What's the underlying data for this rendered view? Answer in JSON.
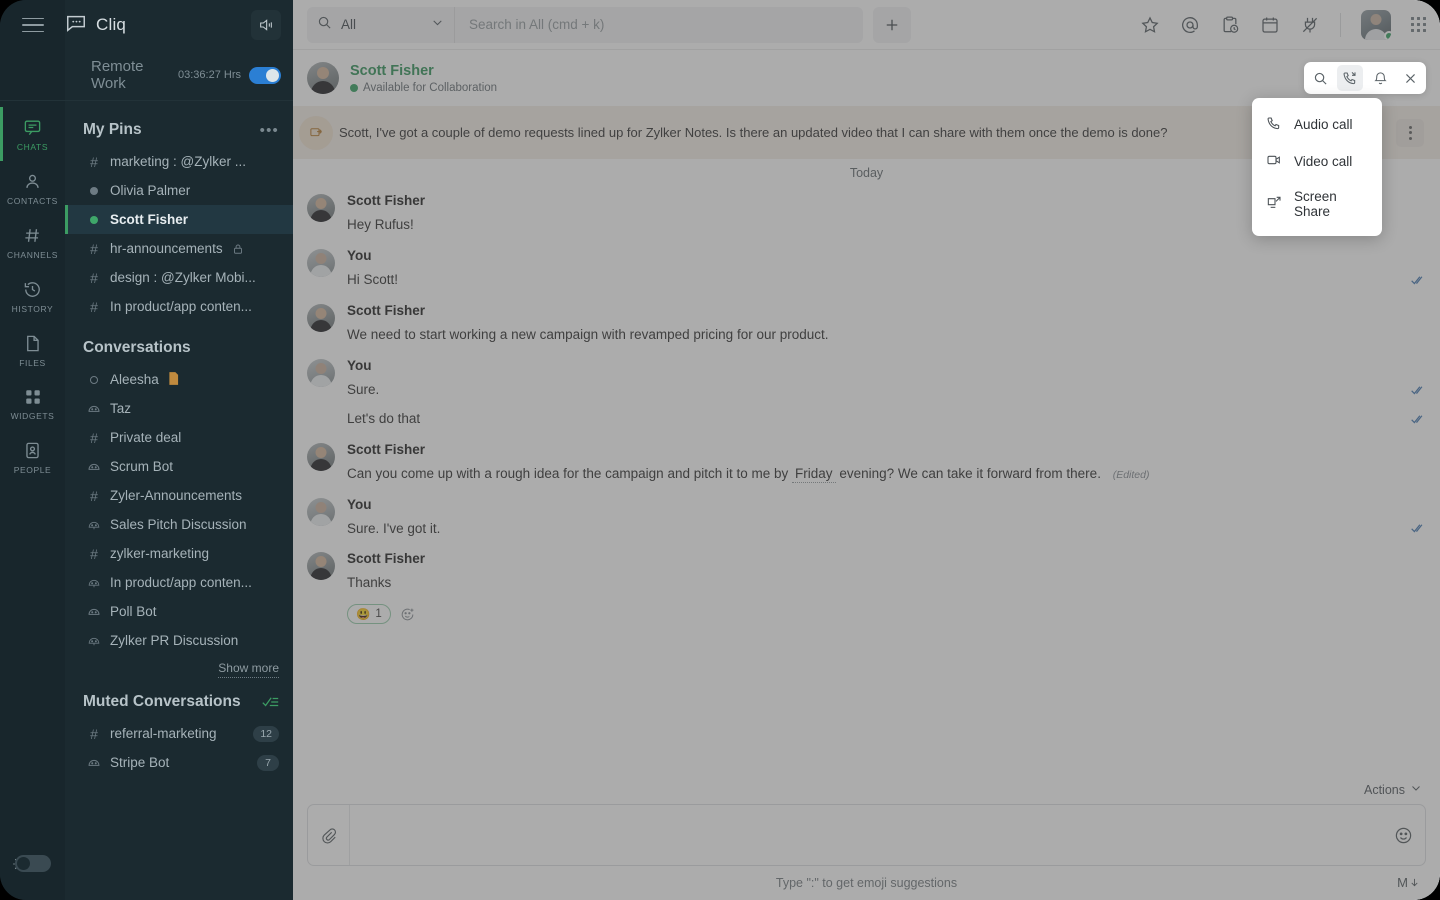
{
  "app": {
    "brand": "Cliq",
    "menu_icon": "hamburger-icon",
    "speaker_icon": "speaker-icon"
  },
  "status_bar": {
    "name": "Remote Work",
    "timer": "03:36:27 Hrs",
    "toggle_on": true
  },
  "rail": {
    "items": [
      {
        "label": "CHATS",
        "icon": "chat-icon",
        "active": true
      },
      {
        "label": "CONTACTS",
        "icon": "person-icon",
        "active": false
      },
      {
        "label": "CHANNELS",
        "icon": "hash-icon",
        "active": false
      },
      {
        "label": "HISTORY",
        "icon": "history-icon",
        "active": false
      },
      {
        "label": "FILES",
        "icon": "file-icon",
        "active": false
      },
      {
        "label": "WIDGETS",
        "icon": "widgets-icon",
        "active": false
      },
      {
        "label": "PEOPLE",
        "icon": "people-card-icon",
        "active": false
      }
    ],
    "theme_toggle": "sun-theme-toggle"
  },
  "sidebar": {
    "pins_title": "My Pins",
    "pins_more": "•••",
    "pins": [
      {
        "label": "marketing : @Zylker ...",
        "icon": "hash",
        "selected": false
      },
      {
        "label": "Olivia Palmer",
        "icon": "dot-grey",
        "selected": false
      },
      {
        "label": "Scott Fisher",
        "icon": "dot-green",
        "selected": true
      },
      {
        "label": "hr-announcements",
        "icon": "hash",
        "selected": false,
        "lock": true
      },
      {
        "label": "design : @Zylker Mobi...",
        "icon": "hash",
        "selected": false
      },
      {
        "label": "In product/app conten...",
        "icon": "hash",
        "selected": false
      }
    ],
    "conversations_title": "Conversations",
    "conversations": [
      {
        "label": "Aleesha",
        "icon": "dot-hollow",
        "file": "🗎"
      },
      {
        "label": "Taz",
        "icon": "bot"
      },
      {
        "label": "Private deal",
        "icon": "hash"
      },
      {
        "label": "Scrum Bot",
        "icon": "bot"
      },
      {
        "label": "Zyler-Announcements",
        "icon": "hash"
      },
      {
        "label": "Sales Pitch Discussion",
        "icon": "group"
      },
      {
        "label": "zylker-marketing",
        "icon": "hash"
      },
      {
        "label": "In product/app conten...",
        "icon": "group"
      },
      {
        "label": "Poll Bot",
        "icon": "bot"
      },
      {
        "label": "Zylker PR Discussion",
        "icon": "group"
      }
    ],
    "show_more": "Show more",
    "muted_title": "Muted Conversations",
    "muted_mark_icon": "mark-read-icon",
    "muted": [
      {
        "label": "referral-marketing",
        "icon": "hash",
        "badge": "12"
      },
      {
        "label": "Stripe Bot",
        "icon": "bot",
        "badge": "7"
      }
    ]
  },
  "topbar": {
    "search_icon": "search-icon",
    "scope_label": "All",
    "scope_chevron": "chevron-down-icon",
    "search_placeholder": "Search in All (cmd + k)",
    "search_value": "",
    "plus_label": "+",
    "icons": [
      {
        "name": "star-icon"
      },
      {
        "name": "mention-at-icon"
      },
      {
        "name": "clipboard-clock-icon"
      },
      {
        "name": "calendar-icon"
      },
      {
        "name": "plug-integrations-icon"
      }
    ],
    "avatar": "user-avatar",
    "apps_grid": "apps-grid-icon"
  },
  "chat_header": {
    "name": "Scott Fisher",
    "status": "Available for Collaboration",
    "buttons": [
      {
        "name": "search-in-chat-icon",
        "active": false
      },
      {
        "name": "call-icon",
        "active": true
      },
      {
        "name": "notifications-bell-icon",
        "active": false
      },
      {
        "name": "close-icon",
        "active": false
      }
    ]
  },
  "call_menu": {
    "items": [
      {
        "label": "Audio call",
        "icon": "phone-icon"
      },
      {
        "label": "Video call",
        "icon": "video-camera-icon"
      },
      {
        "label": "Screen Share",
        "icon": "screen-share-icon"
      }
    ]
  },
  "pinned": {
    "icon": "pin-message-icon",
    "text": "Scott, I've got a couple of demo requests lined up for Zylker Notes. Is there an updated video that I can share with them once the demo is done?",
    "more_icon": "more-vertical-icon"
  },
  "conversation": {
    "day_separator": "Today",
    "groups": [
      {
        "author": "Scott Fisher",
        "side": "scott",
        "lines": [
          {
            "text": "Hey Rufus!",
            "ticks": false
          }
        ]
      },
      {
        "author": "You",
        "side": "you",
        "lines": [
          {
            "text": "Hi Scott!",
            "ticks": true
          }
        ]
      },
      {
        "author": "Scott Fisher",
        "side": "scott",
        "lines": [
          {
            "text": "We need to start working a new campaign with revamped pricing for our product.",
            "ticks": false
          }
        ]
      },
      {
        "author": "You",
        "side": "you",
        "lines": [
          {
            "text": "Sure.",
            "ticks": true
          },
          {
            "text": "Let's do that",
            "ticks": true
          }
        ]
      },
      {
        "author": "Scott Fisher",
        "side": "scott",
        "lines": [
          {
            "pre": "Can you come up with a rough idea for the campaign and pitch it to me by",
            "chip": "Friday",
            "post": "evening? We can take it forward from there.",
            "edited": "(Edited)",
            "ticks": false
          }
        ]
      },
      {
        "author": "You",
        "side": "you",
        "lines": [
          {
            "text": "Sure. I've got it.",
            "ticks": true
          }
        ]
      },
      {
        "author": "Scott Fisher",
        "side": "scott",
        "lines": [
          {
            "text": "Thanks",
            "ticks": false
          }
        ],
        "reactions": {
          "emoji": "😃",
          "count": "1",
          "add_icon": "add-reaction-icon"
        }
      }
    ]
  },
  "composer": {
    "actions_label": "Actions",
    "actions_chevron": "chevron-down-icon",
    "attach_icon": "paperclip-icon",
    "input_value": "",
    "input_placeholder": "",
    "emoji_icon": "emoji-smiley-icon",
    "hint": "Type \":\" to get emoji suggestions",
    "markdown_icon": "markdown-icon",
    "markdown_label": "M"
  },
  "colors": {
    "accent_green": "#3c9c63",
    "sidebar_bg": "#1b2a30",
    "rail_bg": "#18262c",
    "selected_row": "#223842",
    "pinned_bg": "#f4eee8",
    "tick_blue": "#4d7fb5",
    "toggle_blue": "#2b7fd4",
    "badge_bg": "#2e3f47"
  }
}
